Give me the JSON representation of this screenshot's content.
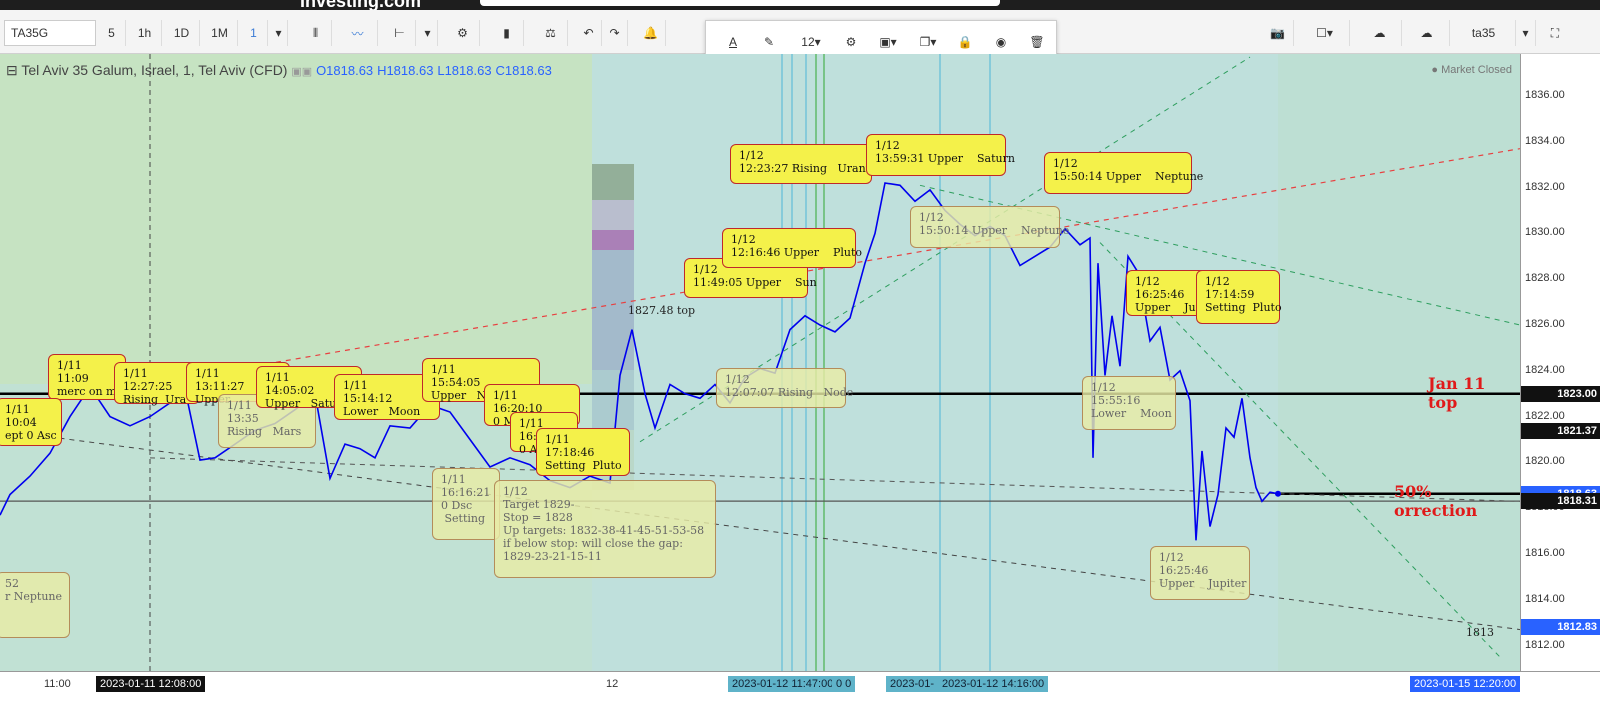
{
  "header": {
    "brand": "Investing.com"
  },
  "toolbar": {
    "symbol": "TA35G",
    "intervals": [
      "5",
      "1h",
      "1D",
      "1M",
      "1"
    ],
    "font_size": "12",
    "layout_name": "ta35"
  },
  "legend": {
    "title": "Tel Aviv 35 Galum, Israel, 1, Tel Aviv (CFD)",
    "o": "O1818.63",
    "h": "H1818.63",
    "l": "L1818.63",
    "c": "C1818.63",
    "market_status": "Market Closed"
  },
  "price_axis": {
    "labels": [
      "1836.00",
      "1834.00",
      "1832.00",
      "1830.00",
      "1828.00",
      "1826.00",
      "1824.00",
      "1822.00",
      "1820.00",
      "1818.00",
      "1816.00",
      "1814.00",
      "1812.00"
    ],
    "tags": [
      {
        "text": "1823.00",
        "value": 1823.0,
        "color": "#111111"
      },
      {
        "text": "1821.37",
        "value": 1821.37,
        "color": "#111111"
      },
      {
        "text": "1818.63",
        "value": 1818.63,
        "color": "#2962ff"
      },
      {
        "text": "1818.31",
        "value": 1818.31,
        "color": "#111111"
      },
      {
        "text": "1812.83",
        "value": 1812.83,
        "color": "#2962ff"
      }
    ]
  },
  "time_axis": {
    "labels": [
      "11:00",
      "12"
    ],
    "tags": [
      "2023-01-11 12:08:00",
      "2023-01-12 11:47:00",
      "0 0",
      "2023-01-12 14:16:00",
      "2023-01-15 12:20:00"
    ],
    "partial": "2023-01-"
  },
  "annotations": {
    "jan11_top": "Jan 11 top",
    "correction": "50% orrection",
    "top_label": "1827.48 top",
    "level_1813": "1813",
    "notes": [
      {
        "text": "1/11\n11:09\nmerc on mc",
        "style": "y"
      },
      {
        "text": "1/11\n12:27:25\nRising  Ura",
        "style": "y"
      },
      {
        "text": "1/11\n13:11:27\nUpper",
        "style": "y"
      },
      {
        "text": "1/11\n13:35\nRising   Mars",
        "style": "g"
      },
      {
        "text": "1/11\n14:05:02\nUpper   Saturn",
        "style": "y"
      },
      {
        "text": "1/11\n15:14:12\nLower   Moon",
        "style": "y"
      },
      {
        "text": "1/11\n15:54:05\nUpper   Neptune",
        "style": "y"
      },
      {
        "text": "1/11\n16:20:10\n0 Mc  Jupiter",
        "style": "y"
      },
      {
        "text": "1/11\n16:\n0 A",
        "style": "y"
      },
      {
        "text": "1/11\n17:18:46\nSetting  Pluto",
        "style": "y"
      },
      {
        "text": "1/11\n16:16:21\n0 Dsc\n Setting",
        "style": "g"
      },
      {
        "text": "1/12\nTarget 1829-\nStop = 1828\nUp targets: 1832-38-41-45-51-53-58\nif below stop: will close the gap:\n1829-23-21-15-11",
        "style": "g"
      },
      {
        "text": "1/12\n11:49:05 Upper    Sun",
        "style": "y"
      },
      {
        "text": "1/12\n12:16:46 Upper    Pluto",
        "style": "y"
      },
      {
        "text": "1/12\n12:23:27 Rising   Uranus",
        "style": "y"
      },
      {
        "text": "1/12\n12:07:07 Rising   Node",
        "style": "g"
      },
      {
        "text": "1/12\n13:59:31 Upper    Saturn",
        "style": "y"
      },
      {
        "text": "1/12\n15:50:14 Upper    Neptune",
        "style": "g"
      },
      {
        "text": "1/12\n15:50:14 Upper    Neptune",
        "style": "y"
      },
      {
        "text": "1/12\n16:25:46\nUpper    Jupiter",
        "style": "y"
      },
      {
        "text": "1/12\n17:14:59\nSetting  Pluto",
        "style": "y"
      },
      {
        "text": "1/12\n15:55:16\nLower    Moon",
        "style": "g"
      },
      {
        "text": "1/12\n16:25:46\nUpper    Jupiter",
        "style": "g"
      },
      {
        "text": "1/11\n10:04\nept 0 Asc",
        "style": "y"
      },
      {
        "text": "52\nr Neptune",
        "style": "g"
      }
    ]
  },
  "colors": {
    "line": "#0000ee",
    "bg": "#c6e3c2",
    "bg2": "#bfe0dc",
    "red": "#e01a1a"
  }
}
